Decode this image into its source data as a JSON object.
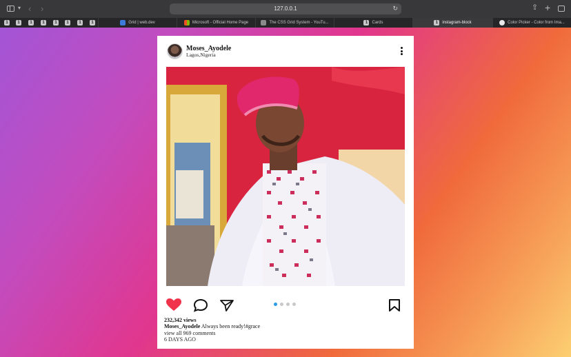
{
  "browser": {
    "address": "127.0.0.1",
    "mini_tab_glyph": "1",
    "tabs": [
      {
        "label": "Grid  |  web.dev",
        "icon": "grid-favicon"
      },
      {
        "label": "Microsoft - Official Home Page",
        "icon": "microsoft-favicon"
      },
      {
        "label": "The CSS Grid System - YouTu...",
        "icon": "video-favicon"
      },
      {
        "label": "Cards",
        "icon": "page-favicon"
      },
      {
        "label": "instagram-block",
        "icon": "page-favicon"
      },
      {
        "label": "Color Picker - Color from Ima...",
        "icon": "color-picker-favicon"
      }
    ]
  },
  "post": {
    "username": "Moses_Ayodele",
    "location": "Lagos,Nigeria",
    "views": "232,342 views",
    "caption_user": "Moses_Ayodele",
    "caption_text": "Always been ready!#grace",
    "comments": "view all 969 comments",
    "time": "6 DAYS AGO",
    "carousel": {
      "count": 4,
      "active": 1
    },
    "liked": true
  },
  "colors": {
    "like": "#f0334a",
    "carousel_active": "#2a9be8",
    "gradient_start": "#a355d6",
    "gradient_end": "#fccf72"
  }
}
